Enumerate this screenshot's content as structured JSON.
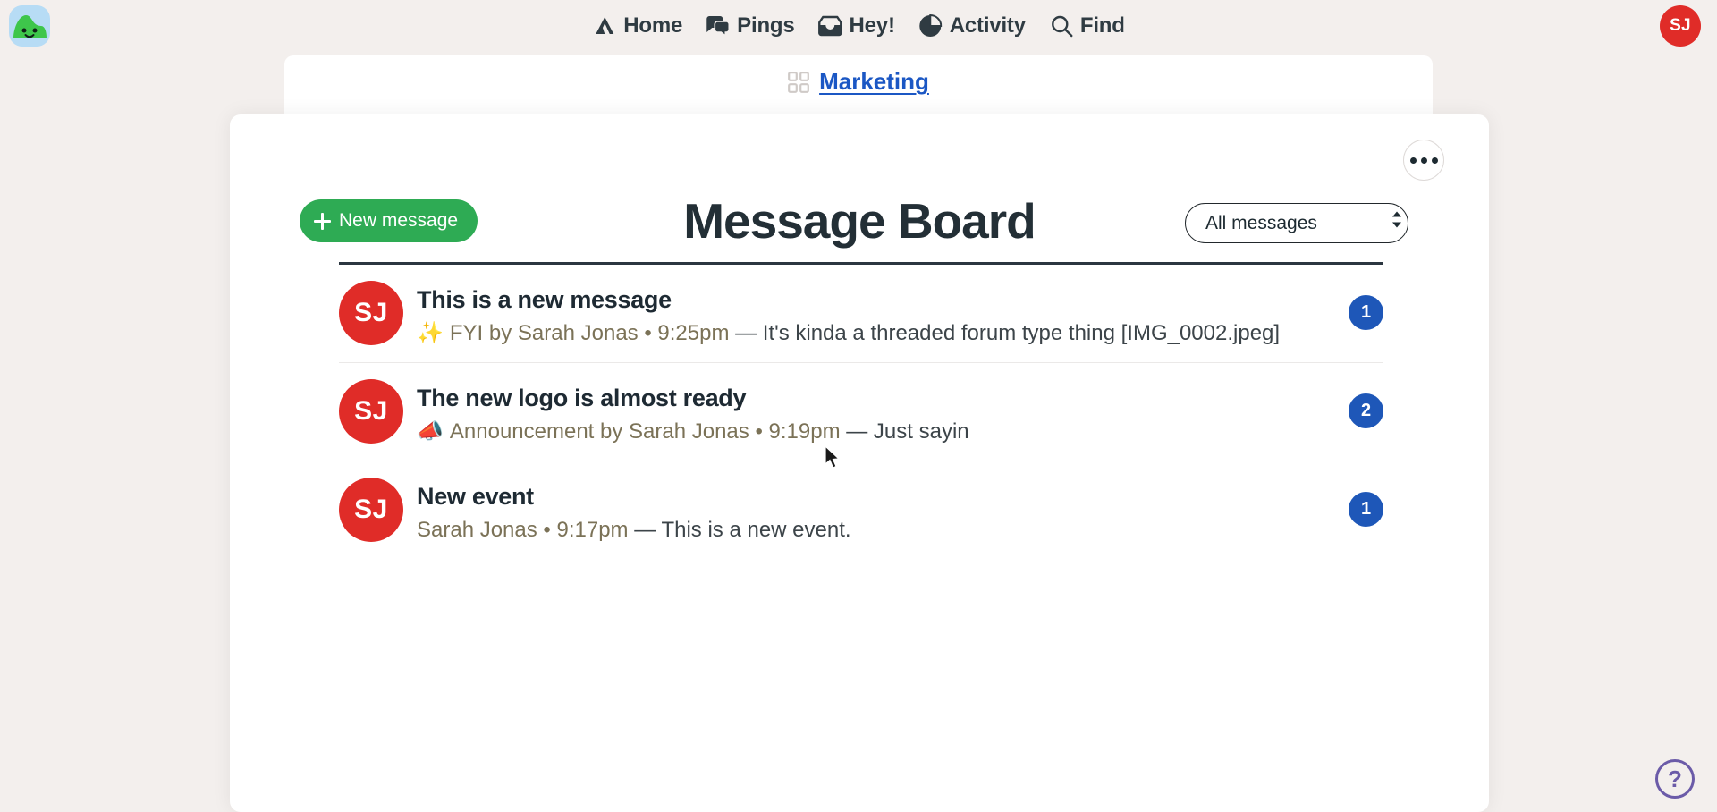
{
  "app": {
    "name": "Basecamp",
    "logo_icon": "basecamp-logo-icon",
    "background_color": "#f3efed"
  },
  "topnav": {
    "items": [
      {
        "label": "Home",
        "icon": "home-icon"
      },
      {
        "label": "Pings",
        "icon": "chat-bubbles-icon"
      },
      {
        "label": "Hey!",
        "icon": "inbox-tray-icon"
      },
      {
        "label": "Activity",
        "icon": "pie-clock-icon"
      },
      {
        "label": "Find",
        "icon": "search-icon"
      }
    ],
    "avatar": {
      "initials": "SJ",
      "color": "#e02c28"
    }
  },
  "breadcrumb": {
    "icon": "grid-squares-icon",
    "label": "Marketing",
    "link_color": "#1b57c4"
  },
  "card": {
    "more_menu_label": "•••",
    "title": "Message Board",
    "new_message_label": "New message",
    "new_message_color": "#2eab54",
    "filter": {
      "selected": "All messages",
      "options": [
        "All messages"
      ]
    }
  },
  "messages": [
    {
      "avatar_initials": "SJ",
      "title": "This is a new message",
      "emoji": "✨",
      "byline": "FYI by Sarah Jonas • 9:25pm",
      "excerpt": "— It's kinda a threaded forum type thing [IMG_0002.jpeg]",
      "comment_count": "1"
    },
    {
      "avatar_initials": "SJ",
      "title": "The new logo is almost ready",
      "emoji": "📣",
      "byline": "Announcement by Sarah Jonas • 9:19pm",
      "excerpt": "— Just sayin",
      "comment_count": "2"
    },
    {
      "avatar_initials": "SJ",
      "title": "New event",
      "emoji": "",
      "byline": "Sarah Jonas • 9:17pm",
      "excerpt": "— This is a new event.",
      "comment_count": "1"
    }
  ],
  "help": {
    "label": "?",
    "color": "#6b5ba8"
  }
}
